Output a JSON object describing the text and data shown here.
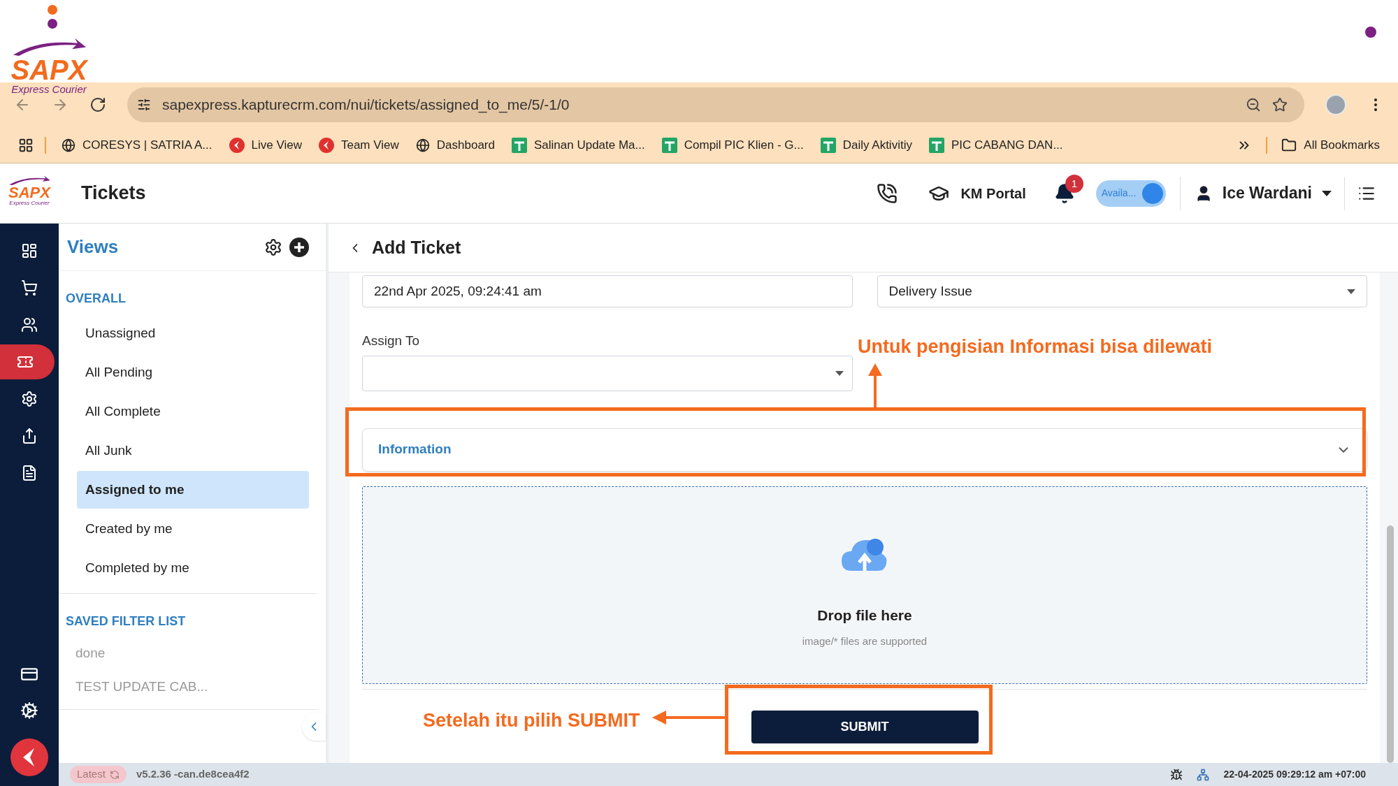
{
  "slide": {
    "logo": {
      "name": "SAPX",
      "tagline": "Express Courier"
    },
    "annotations": [
      {
        "text": "Untuk pengisian Informasi bisa dilewati"
      },
      {
        "text": "Setelah itu pilih SUBMIT"
      }
    ]
  },
  "browser": {
    "url": "sapexpress.kapturecrm.com/nui/tickets/assigned_to_me/5/-1/0",
    "bookmarks": [
      {
        "label": "CORESYS | SATRIA A...",
        "kind": "globe"
      },
      {
        "label": "Live View",
        "kind": "kapture"
      },
      {
        "label": "Team View",
        "kind": "kapture"
      },
      {
        "label": "Dashboard",
        "kind": "globe"
      },
      {
        "label": "Salinan Update Ma...",
        "kind": "sheet"
      },
      {
        "label": "Compil PIC Klien - G...",
        "kind": "sheet"
      },
      {
        "label": "Daily Aktivitiy",
        "kind": "sheet"
      },
      {
        "label": "PIC CABANG DAN...",
        "kind": "sheet"
      }
    ],
    "all_bookmarks": "All Bookmarks"
  },
  "app": {
    "logo": {
      "name": "SAPX",
      "tagline": "Express Courier"
    },
    "title": "Tickets",
    "km_portal": "KM Portal",
    "notifications": "1",
    "availability": {
      "label": "Availa...",
      "on": true
    },
    "user": "Ice Wardani",
    "rail": [
      {
        "kind": "dashboard",
        "selected": false
      },
      {
        "kind": "cart",
        "selected": false
      },
      {
        "kind": "people",
        "selected": false
      },
      {
        "kind": "ticket",
        "selected": true
      },
      {
        "kind": "settings",
        "selected": false
      },
      {
        "kind": "export",
        "selected": false
      },
      {
        "kind": "document",
        "selected": false
      }
    ],
    "rail_bottom": [
      {
        "kind": "card",
        "selected": false
      },
      {
        "kind": "gears",
        "selected": false
      }
    ]
  },
  "views": {
    "title": "Views",
    "sections": [
      {
        "title": "OVERALL",
        "kind": "views",
        "items": [
          {
            "label": "Unassigned",
            "selected": false
          },
          {
            "label": "All Pending",
            "selected": false
          },
          {
            "label": "All Complete",
            "selected": false
          },
          {
            "label": "All Junk",
            "selected": false
          },
          {
            "label": "Assigned to me",
            "selected": true
          },
          {
            "label": "Created by me",
            "selected": false
          },
          {
            "label": "Completed by me",
            "selected": false
          }
        ]
      },
      {
        "title": "SAVED FILTER LIST",
        "kind": "filters",
        "items": [
          {
            "label": "done",
            "selected": false
          },
          {
            "label": "TEST UPDATE CAB...",
            "selected": false
          }
        ]
      }
    ]
  },
  "form": {
    "title": "Add Ticket",
    "fields": [
      {
        "kind": "text",
        "value": "22nd Apr 2025, 09:24:41 am"
      },
      {
        "kind": "select",
        "value": "Delivery Issue"
      }
    ],
    "assign_to": {
      "label": "Assign To"
    },
    "section": {
      "title": "Information",
      "expanded": false
    },
    "dropzone": {
      "title": "Drop file here",
      "hint": "image/* files are supported"
    },
    "submit": "SUBMIT"
  },
  "status_bar": {
    "badge": "Latest",
    "version": "v5.2.36 -can.de8cea4f2",
    "datetime": "22-04-2025 09:29:12 am +07:00"
  }
}
